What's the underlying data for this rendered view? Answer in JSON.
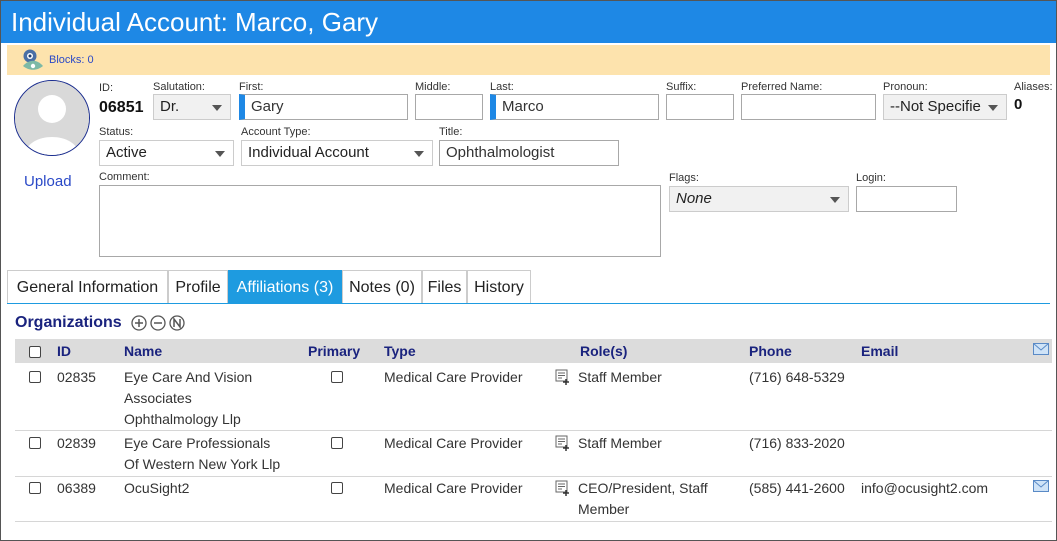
{
  "window": {
    "title": "Individual Account: Marco, Gary"
  },
  "blocks": {
    "label": "Blocks: 0"
  },
  "avatar": {
    "upload_label": "Upload"
  },
  "form": {
    "id": {
      "label": "ID:",
      "value": "06851"
    },
    "salutation": {
      "label": "Salutation:",
      "value": "Dr."
    },
    "first": {
      "label": "First:",
      "value": "Gary"
    },
    "middle": {
      "label": "Middle:",
      "value": ""
    },
    "last": {
      "label": "Last:",
      "value": "Marco"
    },
    "suffix": {
      "label": "Suffix:",
      "value": ""
    },
    "preferred_name": {
      "label": "Preferred Name:",
      "value": ""
    },
    "pronoun": {
      "label": "Pronoun:",
      "value": "--Not Specifie"
    },
    "aliases": {
      "label": "Aliases:",
      "value": "0"
    },
    "status": {
      "label": "Status:",
      "value": "Active"
    },
    "account_type": {
      "label": "Account Type:",
      "value": "Individual Account"
    },
    "title": {
      "label": "Title:",
      "value": "Ophthalmologist"
    },
    "comment": {
      "label": "Comment:",
      "value": ""
    },
    "flags": {
      "label": "Flags:",
      "value": "None"
    },
    "login": {
      "label": "Login:",
      "value": ""
    }
  },
  "tabs": [
    {
      "label": "General Information"
    },
    {
      "label": "Profile"
    },
    {
      "label": "Affiliations (3)"
    },
    {
      "label": "Notes (0)"
    },
    {
      "label": "Files"
    },
    {
      "label": "History"
    }
  ],
  "organizations": {
    "title": "Organizations",
    "columns": {
      "id": "ID",
      "name": "Name",
      "primary": "Primary",
      "type": "Type",
      "roles": "Role(s)",
      "phone": "Phone",
      "email": "Email"
    },
    "rows": [
      {
        "id": "02835",
        "name_lines": [
          "Eye Care And Vision",
          "Associates",
          "Ophthalmology Llp"
        ],
        "type": "Medical Care Provider",
        "role_lines": [
          "Staff Member"
        ],
        "phone": "(716) 648-5329",
        "email": ""
      },
      {
        "id": "02839",
        "name_lines": [
          "Eye Care Professionals",
          "Of Western New York Llp"
        ],
        "type": "Medical Care Provider",
        "role_lines": [
          "Staff Member"
        ],
        "phone": "(716) 833-2020",
        "email": ""
      },
      {
        "id": "06389",
        "name_lines": [
          "OcuSight2"
        ],
        "type": "Medical Care Provider",
        "role_lines": [
          "CEO/President, Staff",
          "Member"
        ],
        "phone": "(585) 441-2600",
        "email": "info@ocusight2.com"
      }
    ]
  },
  "colors": {
    "title_bar": "#1e88e5",
    "blocks_bar": "#fde3ad",
    "active_tab": "#1e9be0",
    "heading": "#1a237e"
  }
}
